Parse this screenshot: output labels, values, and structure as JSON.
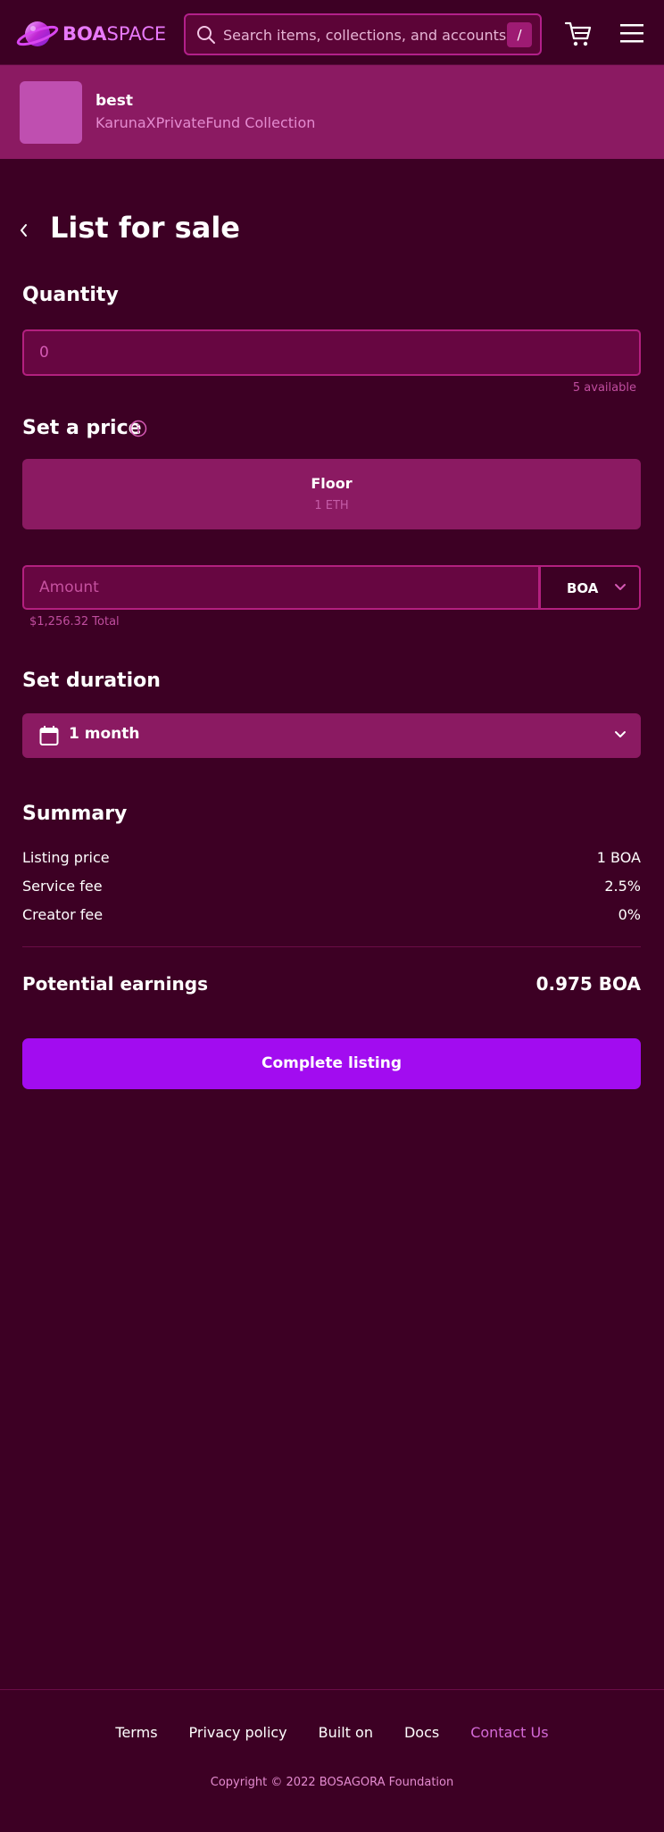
{
  "colors": {
    "background": "#3d0024",
    "panel": "#8b1a62",
    "input": "#670641",
    "accent_button": "#a20cf0",
    "brand": "#e879f9"
  },
  "header": {
    "logo_bold": "BOA",
    "logo_light": "SPACE",
    "search_placeholder": "Search items, collections, and accounts",
    "search_shortcut": "/",
    "cart_icon": "cart-icon",
    "menu_icon": "hamburger-menu-icon"
  },
  "item": {
    "name": "best",
    "collection": "KarunaXPrivateFund Collection"
  },
  "page": {
    "title": "List for sale"
  },
  "quantity": {
    "title": "Quantity",
    "value": "0",
    "available": "5 available"
  },
  "price": {
    "title": "Set a price",
    "floor_label": "Floor",
    "floor_value": "1 ETH",
    "amount_placeholder": "Amount",
    "currency": "BOA",
    "total": "$1,256.32 Total"
  },
  "duration": {
    "title": "Set duration",
    "value": "1 month"
  },
  "summary": {
    "title": "Summary",
    "rows": [
      {
        "label": "Listing price",
        "value": "1 BOA"
      },
      {
        "label": "Service fee",
        "value": "2.5%"
      },
      {
        "label": "Creator fee",
        "value": "0%"
      }
    ],
    "earnings_label": "Potential earnings",
    "earnings_value": "0.975 BOA",
    "button": "Complete listing"
  },
  "footer": {
    "links": [
      "Terms",
      "Privacy policy",
      "Built on",
      "Docs",
      "Contact Us"
    ],
    "copyright": "Copyright © 2022 BOSAGORA Foundation"
  }
}
